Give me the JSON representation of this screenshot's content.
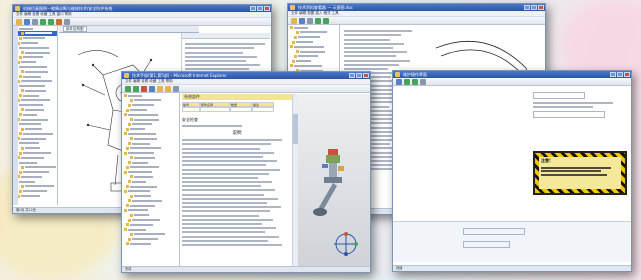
{
  "windows": {
    "w1": {
      "title": "机械仿真图例—故障诊断与维修技术/安全防护系统",
      "menu": "文件 编辑 查看 收藏 工具 窗口 帮助",
      "tab": "部件结构图",
      "tree_root": "一 系统总体",
      "status": "第2页 共12页"
    },
    "w2": {
      "title": "技术资料查看器 — 示意图.doc",
      "menu": "文件 编辑 视图 插入 格式 工具",
      "status": "就绪"
    },
    "w3": {
      "title": "技术手册(第1,第5部) - Microsoft Internet Explorer",
      "menu": "文件 编辑 查看 收藏 工具 帮助",
      "doc_heading": "系统部件",
      "col_headers": [
        "编号",
        "部件名称",
        "数量",
        "备注"
      ],
      "section_title": "安全检查",
      "center_heading": "说明",
      "status": "完成"
    },
    "w4": {
      "title": "维护操作界面",
      "status": "就绪",
      "warn_label": "注意!"
    }
  },
  "accent_colors": {
    "titlebar": "#2b55a8",
    "selection": "#3366cc",
    "warning_yellow": "#f3c400",
    "highlight": "#f3e68a"
  }
}
